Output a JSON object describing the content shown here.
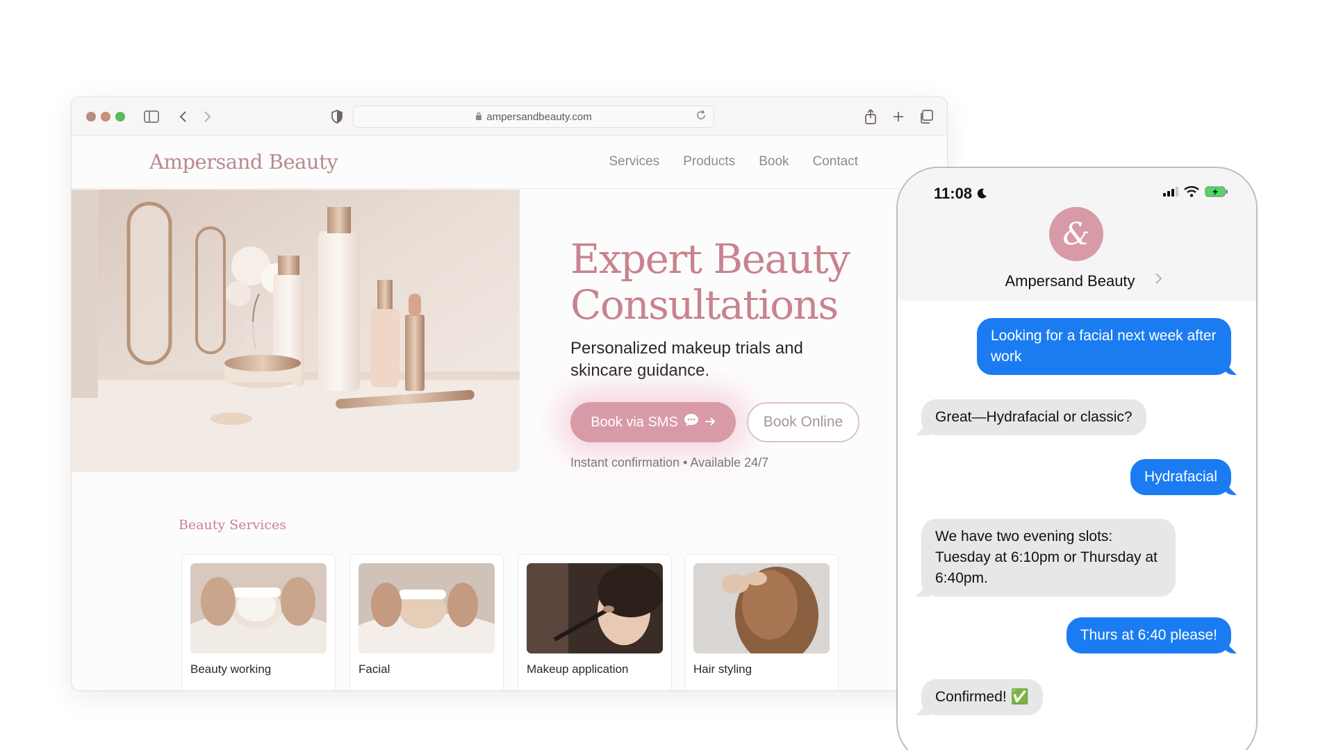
{
  "browser": {
    "url": "ampersandbeauty.com"
  },
  "site": {
    "logo": "Ampersand Beauty",
    "nav": [
      "Services",
      "Products",
      "Book",
      "Contact"
    ],
    "hero": {
      "title_line1": "Expert Beauty",
      "title_line2": "Consultations",
      "subtitle": "Personalized makeup trials and skincare guidance.",
      "sms_button": "Book via SMS",
      "online_button": "Book Online",
      "note": "Instant confirmation • Available 24/7"
    },
    "services": {
      "title": "Beauty Services",
      "cards": [
        "Beauty working",
        "Facial",
        "Makeup application",
        "Hair styling"
      ]
    }
  },
  "phone": {
    "time": "11:08",
    "contact_initial": "&",
    "contact_name": "Ampersand Beauty",
    "messages": [
      {
        "from": "out",
        "text": "Looking for a facial next week after work"
      },
      {
        "from": "in",
        "text": "Great—Hydrafacial or classic?"
      },
      {
        "from": "out",
        "text": "Hydrafacial"
      },
      {
        "from": "in",
        "text": "We have two evening slots: Tuesday at 6:10pm or Thursday at 6:40pm."
      },
      {
        "from": "out",
        "text": "Thurs at 6:40 please!"
      },
      {
        "from": "in",
        "text": "Confirmed! ✅"
      }
    ]
  },
  "colors": {
    "brand_pink": "#c8838e",
    "button_pink": "#d99aa7",
    "imessage_blue": "#1b7cf2",
    "incoming_gray": "#e7e7ea"
  },
  "icons": [
    "sidebar-icon",
    "back-icon",
    "forward-icon",
    "shield-icon",
    "lock-icon",
    "reload-icon",
    "share-icon",
    "new-tab-icon",
    "tabs-icon",
    "chat-bubble-icon",
    "arrow-right-icon",
    "moon-icon",
    "signal-icon",
    "wifi-icon",
    "battery-icon",
    "chevron-right-icon"
  ]
}
